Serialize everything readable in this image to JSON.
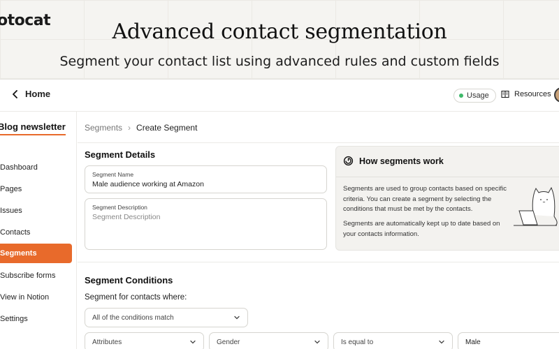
{
  "hero": {
    "brand": "otocat",
    "title": "Advanced contact segmentation",
    "subtitle": "Segment your contact list using advanced rules and custom fields"
  },
  "topbar": {
    "back_label": "Home",
    "usage_label": "Usage",
    "resources_label": "Resources"
  },
  "sidebar": {
    "workspace": "Blog newsletter",
    "items": [
      {
        "label": "Dashboard",
        "active": false
      },
      {
        "label": "Pages",
        "active": false
      },
      {
        "label": "Issues",
        "active": false
      },
      {
        "label": "Contacts",
        "active": false
      },
      {
        "label": "Segments",
        "active": true
      },
      {
        "label": "Subscribe forms",
        "active": false
      },
      {
        "label": "View in Notion",
        "active": false
      },
      {
        "label": "Settings",
        "active": false
      }
    ]
  },
  "breadcrumb": {
    "parent": "Segments",
    "current": "Create Segment"
  },
  "details": {
    "heading": "Segment Details",
    "name_label": "Segment Name",
    "name_value": "Male audience working at Amazon",
    "desc_label": "Segment Description",
    "desc_placeholder": "Segment Description"
  },
  "how": {
    "title": "How segments work",
    "p1": "Segments are used to group contacts based on specific criteria. You can create a segment by selecting the conditions that must be met by the contacts.",
    "p2": "Segments are automatically kept up to date based on your contacts information."
  },
  "conditions": {
    "heading": "Segment Conditions",
    "label": "Segment for contacts where:",
    "match": "All of the conditions match",
    "attribute": "Attributes",
    "field": "Gender",
    "operator": "Is equal to",
    "value": "Male"
  },
  "colors": {
    "accent": "#e86a2b",
    "usage_dot": "#3fb96a"
  },
  "icons": [
    "chevron-left-icon",
    "book-icon",
    "segment-icon",
    "chevron-down-icon",
    "cat-illustration"
  ]
}
